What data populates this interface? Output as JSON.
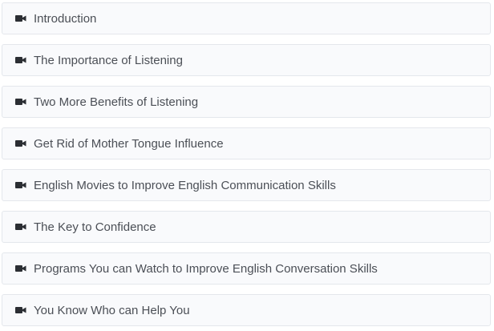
{
  "lessons": {
    "icon": "video-camera-icon",
    "icon_color": "#2b2e33",
    "items": [
      {
        "title": "Introduction"
      },
      {
        "title": "The Importance of Listening"
      },
      {
        "title": "Two More Benefits of Listening"
      },
      {
        "title": "Get Rid of Mother Tongue Influence"
      },
      {
        "title": "English Movies to Improve English Communication Skills"
      },
      {
        "title": "The Key to Confidence"
      },
      {
        "title": "Programs You can Watch to Improve English Conversation Skills"
      },
      {
        "title": "You Know Who can Help You"
      }
    ]
  }
}
